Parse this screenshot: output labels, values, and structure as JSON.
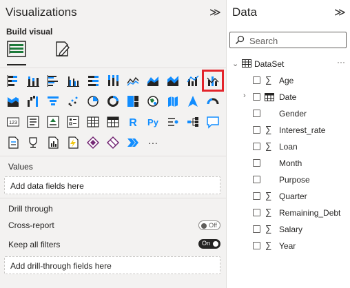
{
  "visualizations": {
    "title": "Visualizations",
    "collapse_glyph": "≫",
    "build_visual_label": "Build visual",
    "selected_visual": "combo-chart",
    "values_label": "Values",
    "values_placeholder": "Add data fields here",
    "drill_through_label": "Drill through",
    "cross_report_label": "Cross-report",
    "cross_report_state": "Off",
    "keep_filters_label": "Keep all filters",
    "keep_filters_state": "On",
    "drill_placeholder": "Add drill-through fields here",
    "more_glyph": "···",
    "icons": [
      [
        "stacked-bar-chart-icon",
        "stacked-column-chart-icon",
        "clustered-bar-chart-icon",
        "clustered-column-chart-icon",
        "bar-100-chart-icon",
        "column-100-chart-icon",
        "line-chart-icon",
        "area-chart-icon",
        "stacked-area-chart-icon",
        "line-clustered-column-chart-icon",
        "combo-chart-icon"
      ],
      [
        "ribbon-chart-icon",
        "waterfall-chart-icon",
        "funnel-chart-icon",
        "scatter-chart-icon",
        "pie-chart-icon",
        "donut-chart-icon",
        "treemap-icon",
        "map-icon",
        "filled-map-icon",
        "azure-map-icon",
        "gauge-icon"
      ],
      [
        "card-icon",
        "multi-row-card-icon",
        "kpi-icon",
        "slicer-icon",
        "table-icon",
        "matrix-icon",
        "r-visual-icon",
        "python-visual-icon",
        "key-influencers-icon",
        "decomposition-tree-icon",
        "qna-icon"
      ],
      [
        "paginated-report-icon",
        "trophy-goals-icon",
        "smart-narrative-icon",
        "power-automate-icon",
        "power-apps-icon",
        "diamond-visual-icon",
        "sequence-visual-icon",
        "more-visuals-icon"
      ]
    ]
  },
  "data_pane": {
    "title": "Data",
    "collapse_glyph": "≫",
    "search_placeholder": "Search",
    "more_glyph": "···",
    "dataset_name": "DataSet",
    "fields": [
      {
        "name": "Age",
        "sigma": "∑"
      },
      {
        "name": "Date",
        "calendar": true
      },
      {
        "name": "Gender"
      },
      {
        "name": "Interest_rate",
        "sigma": "∑"
      },
      {
        "name": "Loan",
        "sigma": "∑"
      },
      {
        "name": "Month"
      },
      {
        "name": "Purpose"
      },
      {
        "name": "Quarter",
        "sigma": "∑"
      },
      {
        "name": "Remaining_Debt",
        "sigma": "∑"
      },
      {
        "name": "Salary",
        "sigma": "∑"
      },
      {
        "name": "Year",
        "sigma": "∑"
      }
    ]
  },
  "colors": {
    "accent_blue": "#118dff",
    "dark_icon": "#252423",
    "highlight_red": "#e3242b",
    "toggle_on": "#252423"
  }
}
